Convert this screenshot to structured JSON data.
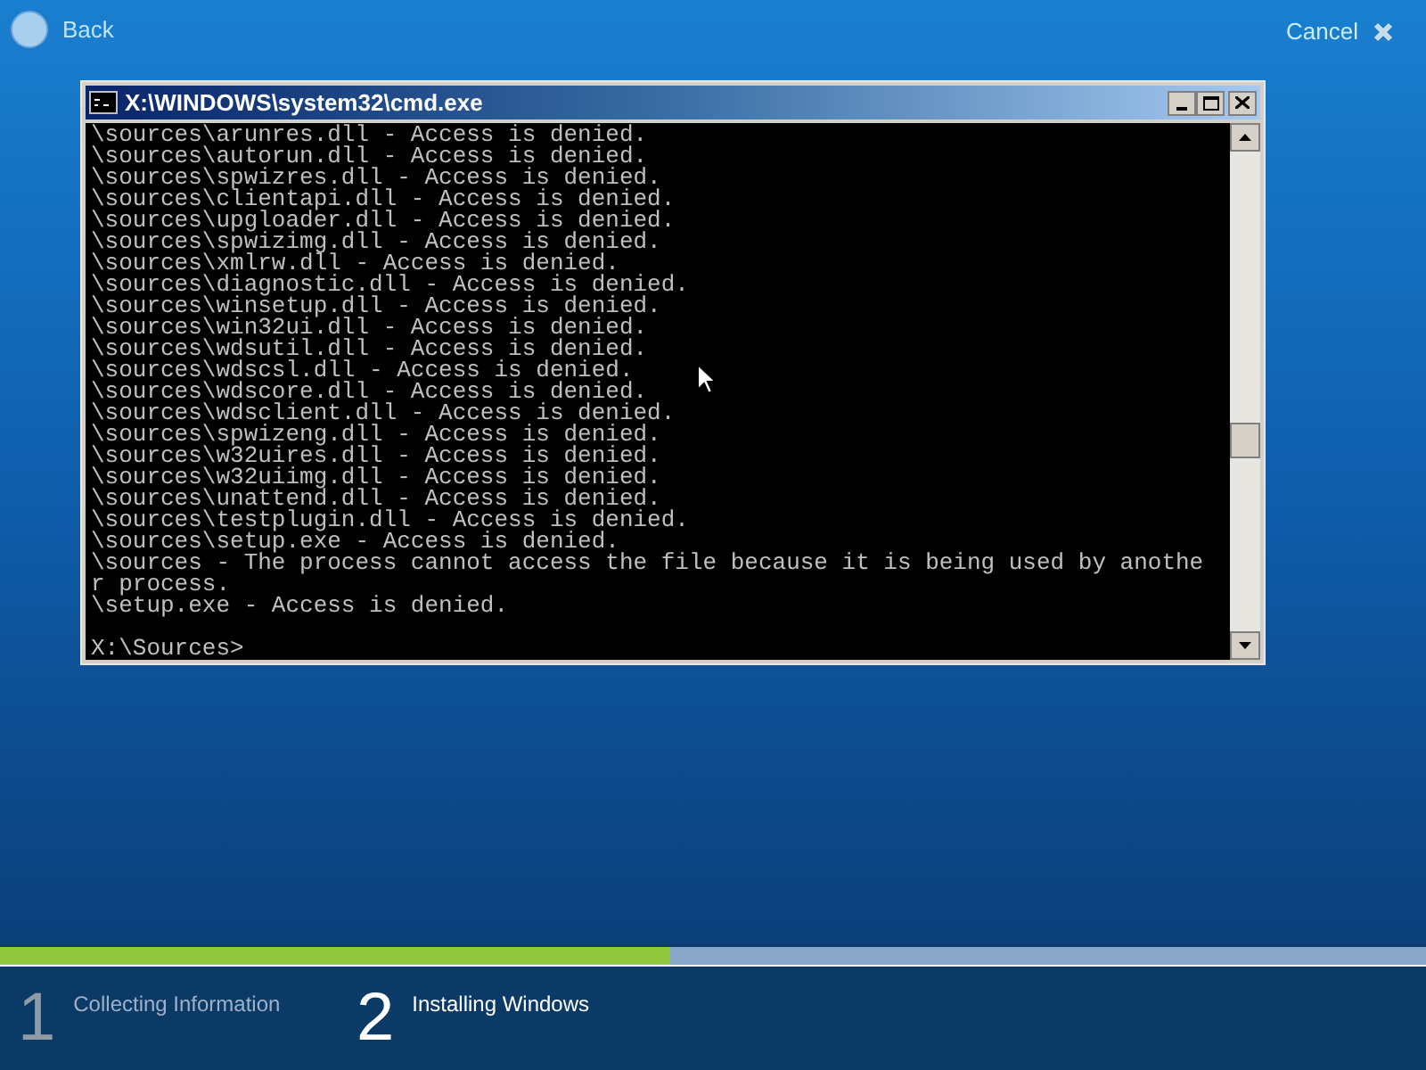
{
  "header": {
    "back": "Back",
    "cancel": "Cancel"
  },
  "console": {
    "title": "X:\\WINDOWS\\system32\\cmd.exe",
    "lines": [
      "\\sources\\arunres.dll - Access is denied.",
      "\\sources\\autorun.dll - Access is denied.",
      "\\sources\\spwizres.dll - Access is denied.",
      "\\sources\\clientapi.dll - Access is denied.",
      "\\sources\\upgloader.dll - Access is denied.",
      "\\sources\\spwizimg.dll - Access is denied.",
      "\\sources\\xmlrw.dll - Access is denied.",
      "\\sources\\diagnostic.dll - Access is denied.",
      "\\sources\\winsetup.dll - Access is denied.",
      "\\sources\\win32ui.dll - Access is denied.",
      "\\sources\\wdsutil.dll - Access is denied.",
      "\\sources\\wdscsl.dll - Access is denied.",
      "\\sources\\wdscore.dll - Access is denied.",
      "\\sources\\wdsclient.dll - Access is denied.",
      "\\sources\\spwizeng.dll - Access is denied.",
      "\\sources\\w32uires.dll - Access is denied.",
      "\\sources\\w32uiimg.dll - Access is denied.",
      "\\sources\\unattend.dll - Access is denied.",
      "\\sources\\testplugin.dll - Access is denied.",
      "\\sources\\setup.exe - Access is denied.",
      "\\sources - The process cannot access the file because it is being used by anothe",
      "r process.",
      "\\setup.exe - Access is denied."
    ],
    "prompt": "X:\\Sources>"
  },
  "progress": {
    "level": 0.47
  },
  "steps": [
    {
      "number": "1",
      "label": "Collecting Information",
      "active": false
    },
    {
      "number": "2",
      "label": "Installing Windows",
      "active": true
    }
  ]
}
